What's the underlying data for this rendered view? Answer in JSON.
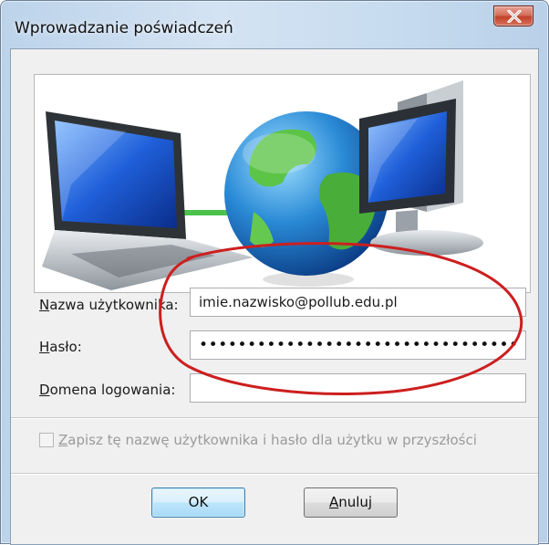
{
  "window": {
    "title": "Wprowadzanie poświadczeń",
    "close_glyph": "X"
  },
  "form": {
    "username_label_accel": "N",
    "username_label_rest": "azwa użytkownika:",
    "username_value": "imie.nazwisko@pollub.edu.pl",
    "password_label_accel": "H",
    "password_label_rest": "asło:",
    "password_masked": "•••••••••••••••••••••••••••••••••",
    "domain_label_accel": "D",
    "domain_label_rest": "omena logowania:",
    "domain_value": ""
  },
  "remember": {
    "label_accel": "Z",
    "label_rest": "apisz tę nazwę użytkownika i hasło dla użytku w przyszłości",
    "checked": false,
    "enabled": false
  },
  "buttons": {
    "ok_label": "OK",
    "cancel_accel": "A",
    "cancel_rest": "nuluj"
  },
  "icons": [
    "close-icon",
    "laptop-icon",
    "globe-icon",
    "desktop-computer-icon",
    "checkbox-icon"
  ],
  "colors": {
    "close_button": "#c2412a",
    "annotation_ellipse": "#cc1f1f",
    "network_line": "#4cc24c",
    "default_button_border": "#3c7fb1"
  }
}
